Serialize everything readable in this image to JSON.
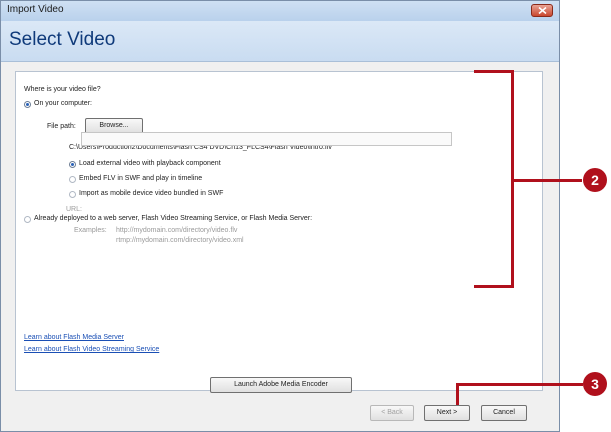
{
  "window": {
    "title": "Import Video",
    "close_icon": "close-icon"
  },
  "header": {
    "title": "Select Video"
  },
  "form": {
    "question": "Where is your video file?",
    "on_computer_label": "On your computer:",
    "file_path_label": "File path:",
    "browse_label": "Browse...",
    "file_path_value": "C:\\Users\\Production2\\Documents\\Flash CS4 DVD\\Ch13_FLCS4\\Flash Video\\intro.flv",
    "options": [
      {
        "label": "Load external video with playback component",
        "selected": true
      },
      {
        "label": "Embed FLV in SWF and play in timeline",
        "selected": false
      },
      {
        "label": "Import as mobile device video bundled in SWF",
        "selected": false
      }
    ],
    "deployed_label": "Already deployed to a web server, Flash Video Streaming Service, or Flash Media Server:",
    "url_label": "URL:",
    "url_value": "",
    "examples_label": "Examples:",
    "example_1": "http://mydomain.com/directory/video.flv",
    "example_2": "rtmp://mydomain.com/directory/video.xml"
  },
  "links": {
    "media_server": "Learn about Flash Media Server",
    "streaming_service": "Learn about Flash Video Streaming Service"
  },
  "buttons": {
    "launch_encoder": "Launch Adobe Media Encoder",
    "back": "< Back",
    "next": "Next >",
    "cancel": "Cancel"
  },
  "callouts": {
    "step_2": "2",
    "step_3": "3"
  },
  "colors": {
    "callout": "#b0101c",
    "title": "#0f3a7a",
    "link": "#1a4fb5"
  }
}
